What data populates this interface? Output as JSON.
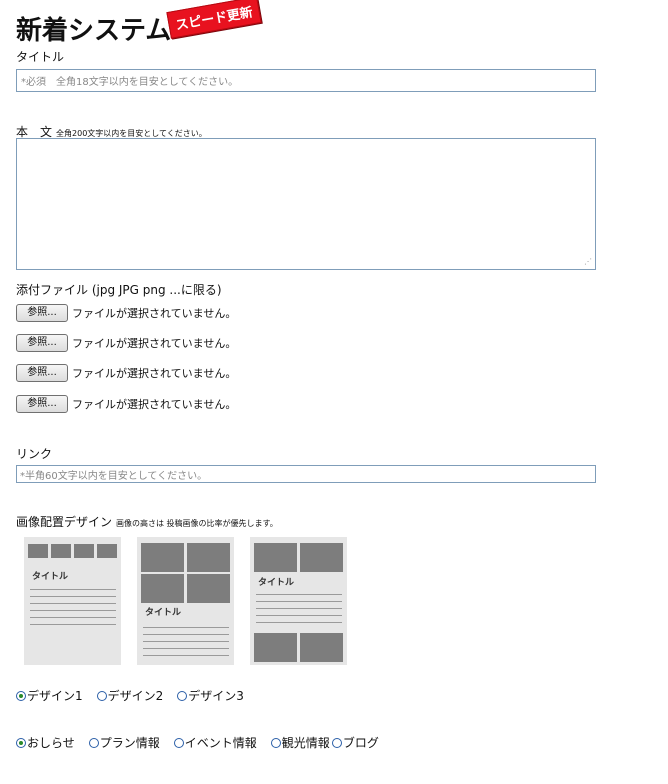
{
  "header": {
    "title": "新着システム",
    "badge": "スピード更新"
  },
  "title_field": {
    "label": "タイトル",
    "placeholder": "*必須　全角18文字以内を目安としてください。"
  },
  "body_field": {
    "label": "本　文",
    "note": "全角200文字以内を目安としてください。"
  },
  "attachments": {
    "label": "添付ファイル (jpg JPG png ...に限る)",
    "items": [
      {
        "button": "参照...",
        "status": "ファイルが選択されていません。"
      },
      {
        "button": "参照...",
        "status": "ファイルが選択されていません。"
      },
      {
        "button": "参照...",
        "status": "ファイルが選択されていません。"
      },
      {
        "button": "参照...",
        "status": "ファイルが選択されていません。"
      }
    ]
  },
  "link_field": {
    "label": "リンク",
    "placeholder": "*半角60文字以内を目安としてください。"
  },
  "design": {
    "label": "画像配置デザイン",
    "note": "画像の高さは 投稿画像の比率が優先します。",
    "thumbnail_label": "タイトル",
    "options": [
      {
        "label": "デザイン1",
        "checked": true
      },
      {
        "label": "デザイン2",
        "checked": false
      },
      {
        "label": "デザイン3",
        "checked": false
      }
    ]
  },
  "category": {
    "options": [
      {
        "label": "おしらせ",
        "checked": true
      },
      {
        "label": "プラン情報",
        "checked": false
      },
      {
        "label": "イベント情報",
        "checked": false
      },
      {
        "label": "観光情報",
        "checked": false
      },
      {
        "label": "ブログ",
        "checked": false
      }
    ]
  }
}
